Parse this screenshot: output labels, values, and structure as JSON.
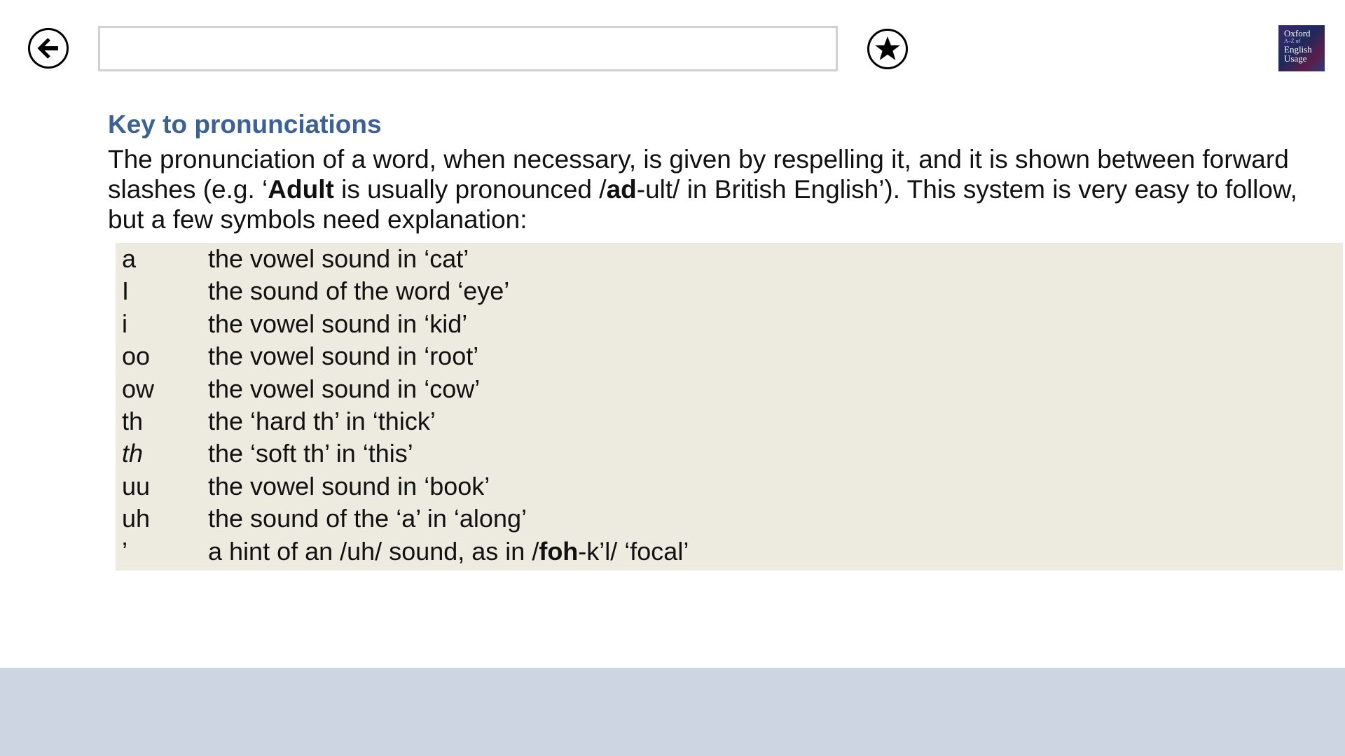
{
  "toolbar": {
    "back_icon": "arrow-left-circle-icon",
    "search_value": "",
    "search_placeholder": "",
    "favorite_icon": "star-circle-icon",
    "logo": {
      "line1": "Oxford",
      "line2": "A–Z of",
      "line3": "English",
      "line4": "Usage"
    }
  },
  "article": {
    "heading": "Key to pronunciations",
    "intro": {
      "part1": "The pronunciation of a word, when necessary, is given by respelling it, and it is shown between forward slashes (e.g. ‘",
      "bold1": "Adult",
      "part2": " is usually pronounced /",
      "bold2": "ad",
      "part3": "-ult/ in British English’). This system is very easy to follow, but a few symbols need explanation:"
    },
    "key": [
      {
        "symbol": "a",
        "desc": "the vowel sound in ‘cat’"
      },
      {
        "symbol": "I",
        "desc": "the sound of the word ‘eye’"
      },
      {
        "symbol": "i",
        "desc": "the vowel sound in ‘kid’"
      },
      {
        "symbol": "oo",
        "desc": "the vowel sound in ‘root’"
      },
      {
        "symbol": "ow",
        "desc": "the vowel sound in ‘cow’"
      },
      {
        "symbol": "th",
        "desc": "the ‘hard th’ in ‘thick’"
      },
      {
        "symbol": "th",
        "desc": "the ‘soft th’ in ‘this’"
      },
      {
        "symbol": "uu",
        "desc": "the vowel sound in ‘book’"
      },
      {
        "symbol": "uh",
        "desc": "the sound of the ‘a’ in ‘along’"
      },
      {
        "symbol": "’",
        "desc_part1": "a hint of an /uh/ sound, as in /",
        "desc_bold": "foh",
        "desc_part2": "-k’l/ ‘focal’"
      }
    ]
  },
  "colors": {
    "heading": "#3b6195",
    "key_background": "#edebe0",
    "bottom_band": "#cdd5e2",
    "search_border": "#d0d0d0"
  }
}
